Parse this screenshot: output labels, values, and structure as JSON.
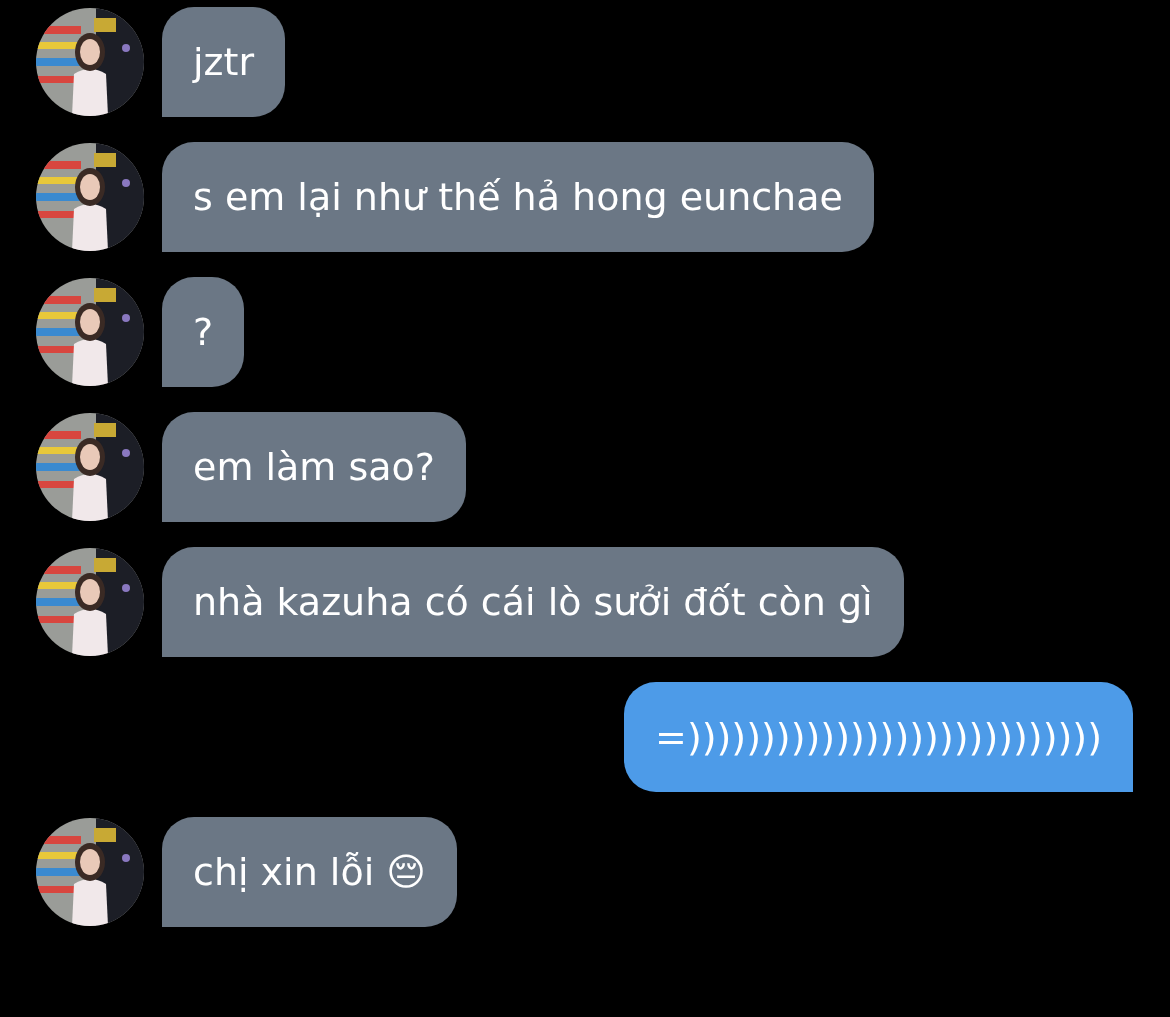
{
  "messages": [
    {
      "kind": "incoming",
      "text": "jztr"
    },
    {
      "kind": "incoming",
      "text": "s em lại như thế hả hong eunchae"
    },
    {
      "kind": "incoming",
      "text": "?"
    },
    {
      "kind": "incoming",
      "text": "em làm sao?"
    },
    {
      "kind": "incoming",
      "text": "nhà kazuha có cái lò sưởi đốt còn gì"
    },
    {
      "kind": "outgoing",
      "text": "=))))))))))))))))))))))))))))"
    },
    {
      "kind": "incoming",
      "text": "chị xin lỗi 😔"
    }
  ]
}
